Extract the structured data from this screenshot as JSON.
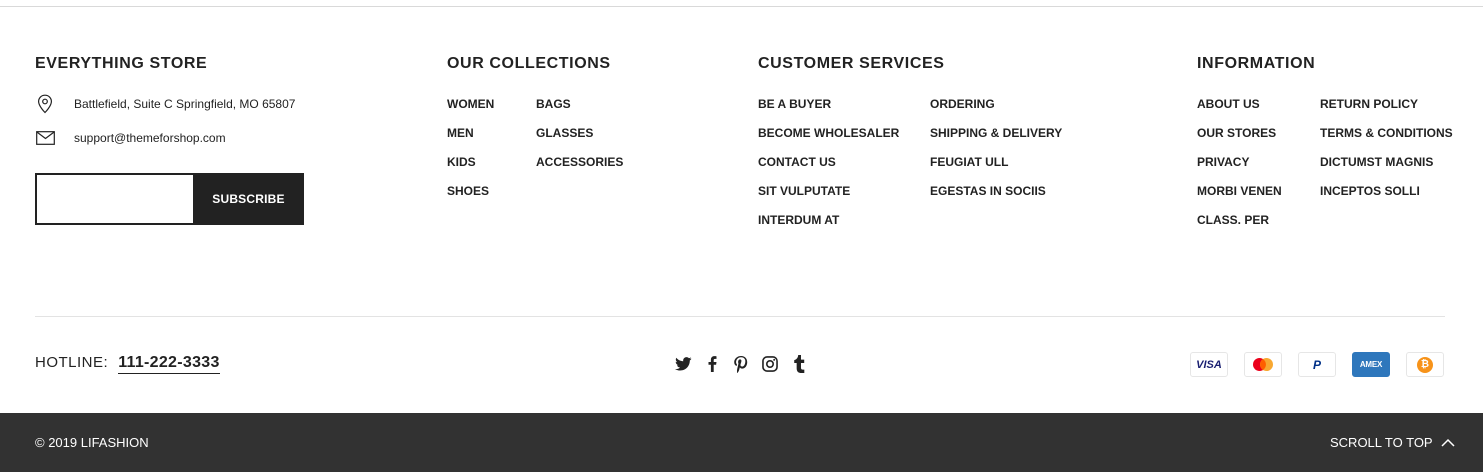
{
  "store": {
    "title": "EVERYTHING STORE",
    "address": "Battlefield, Suite C Springfield, MO 65807",
    "email": "support@themeforshop.com",
    "subscribe_label": "SUBSCRIBE",
    "subscribe_placeholder": "",
    "address_icon": "map-pin-icon",
    "email_icon": "mail-icon"
  },
  "collections": {
    "title": "OUR COLLECTIONS",
    "col1": [
      "WOMEN",
      "MEN",
      "KIDS",
      "SHOES"
    ],
    "col2": [
      "BAGS",
      "GLASSES",
      "ACCESSORIES"
    ]
  },
  "customer_services": {
    "title": "CUSTOMER SERVICES",
    "col1": [
      "BE A BUYER",
      "BECOME WHOLESALER",
      "CONTACT US",
      "SIT VULPUTATE",
      "INTERDUM AT"
    ],
    "col2": [
      "ORDERING",
      "SHIPPING & DELIVERY",
      "FEUGIAT ULL",
      "EGESTAS IN SOCIIS"
    ]
  },
  "information": {
    "title": "INFORMATION",
    "col1": [
      "ABOUT US",
      "OUR STORES",
      "PRIVACY",
      "MORBI VENEN",
      "CLASS. PER"
    ],
    "col2": [
      "RETURN POLICY",
      "TERMS & CONDITIONS",
      "DICTUMST MAGNIS",
      "INCEPTOS SOLLI"
    ]
  },
  "hotline": {
    "label": "HOTLINE:",
    "number": "111-222-3333"
  },
  "social": [
    "twitter-icon",
    "facebook-icon",
    "pinterest-icon",
    "instagram-icon",
    "tumblr-icon"
  ],
  "payments": [
    {
      "name": "visa",
      "label": "VISA",
      "color": "#1a1f71"
    },
    {
      "name": "mastercard",
      "label": "",
      "color": "#eb001b"
    },
    {
      "name": "paypal",
      "label": "P",
      "color": "#003087"
    },
    {
      "name": "amex",
      "label": "AMEX",
      "color": "#2e77bc"
    },
    {
      "name": "bitcoin",
      "label": "₿",
      "color": "#f7931a"
    }
  ],
  "footer": {
    "copyright": "© 2019 LIFASHION",
    "scroll_top": "SCROLL TO TOP"
  },
  "colors": {
    "dark": "#222222",
    "bottom_bar": "#323232"
  }
}
